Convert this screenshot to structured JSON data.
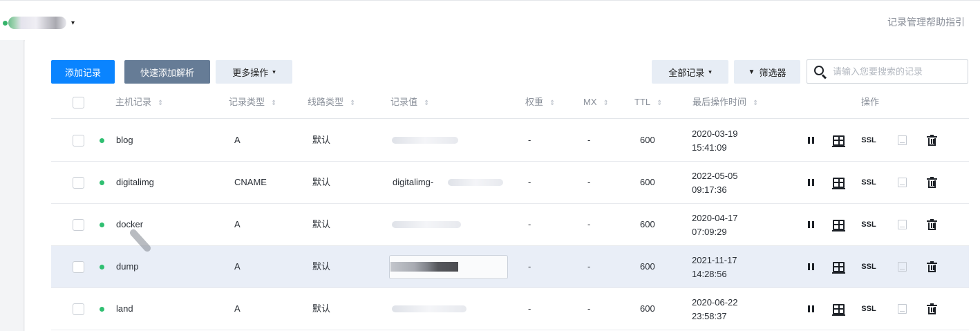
{
  "topbar": {
    "domain_caret": "▾",
    "help_link": "记录管理帮助指引"
  },
  "toolbar": {
    "add_label": "添加记录",
    "quick_add_label": "快速添加解析",
    "more_label": "更多操作",
    "all_records_label": "全部记录",
    "filter_label": "筛选器",
    "caret": "▾",
    "funnel": "▼",
    "search_placeholder": "请输入您要搜索的记录"
  },
  "table": {
    "headers": {
      "host": "主机记录",
      "type": "记录类型",
      "line": "线路类型",
      "value": "记录值",
      "weight": "权重",
      "mx": "MX",
      "ttl": "TTL",
      "last_op": "最后操作时间",
      "actions": "操作"
    },
    "sort_glyph": "⇕",
    "ssl_label": "SSL",
    "rows": [
      {
        "host": "blog",
        "type": "A",
        "line": "默认",
        "value": "",
        "weight": "-",
        "mx": "-",
        "ttl": "600",
        "date": "2020-03-19",
        "time": "15:41:09"
      },
      {
        "host": "digitalimg",
        "type": "CNAME",
        "line": "默认",
        "value": "digitalimg-",
        "weight": "-",
        "mx": "-",
        "ttl": "600",
        "date": "2022-05-05",
        "time": "09:17:36"
      },
      {
        "host": "docker",
        "type": "A",
        "line": "默认",
        "value": "",
        "weight": "-",
        "mx": "-",
        "ttl": "600",
        "date": "2020-04-17",
        "time": "07:09:29"
      },
      {
        "host": "dump",
        "type": "A",
        "line": "默认",
        "value": "",
        "weight": "-",
        "mx": "-",
        "ttl": "600",
        "date": "2021-11-17",
        "time": "14:28:56"
      },
      {
        "host": "land",
        "type": "A",
        "line": "默认",
        "value": "",
        "weight": "-",
        "mx": "-",
        "ttl": "600",
        "date": "2020-06-22",
        "time": "23:58:37"
      }
    ]
  }
}
